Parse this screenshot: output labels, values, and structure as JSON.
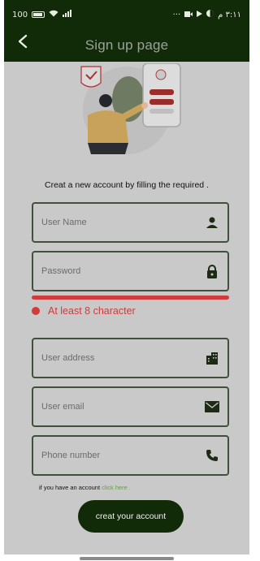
{
  "status_bar": {
    "left_text": "100",
    "time_text": "٣:١١ م"
  },
  "app_bar": {
    "title": "Sign up page"
  },
  "intro_text": "Creat a new account by filling the required .",
  "fields": {
    "username": {
      "placeholder": "User Name",
      "icon": "person-icon"
    },
    "password": {
      "placeholder": "Password",
      "icon": "lock-icon"
    },
    "address": {
      "placeholder": "User address",
      "icon": "building-icon"
    },
    "email": {
      "placeholder": "User email",
      "icon": "mail-icon"
    },
    "phone": {
      "placeholder": "Phone number",
      "icon": "phone-icon"
    }
  },
  "password_strength": {
    "message": "At least 8 character",
    "color": "#d13b3b"
  },
  "login_prompt": {
    "text": "if you have an account",
    "link": "click here ."
  },
  "submit_label": "creat your account",
  "colors": {
    "primary": "#112a07",
    "error": "#d13b3b",
    "link": "#5fa33b",
    "background": "#c9c9c9"
  }
}
